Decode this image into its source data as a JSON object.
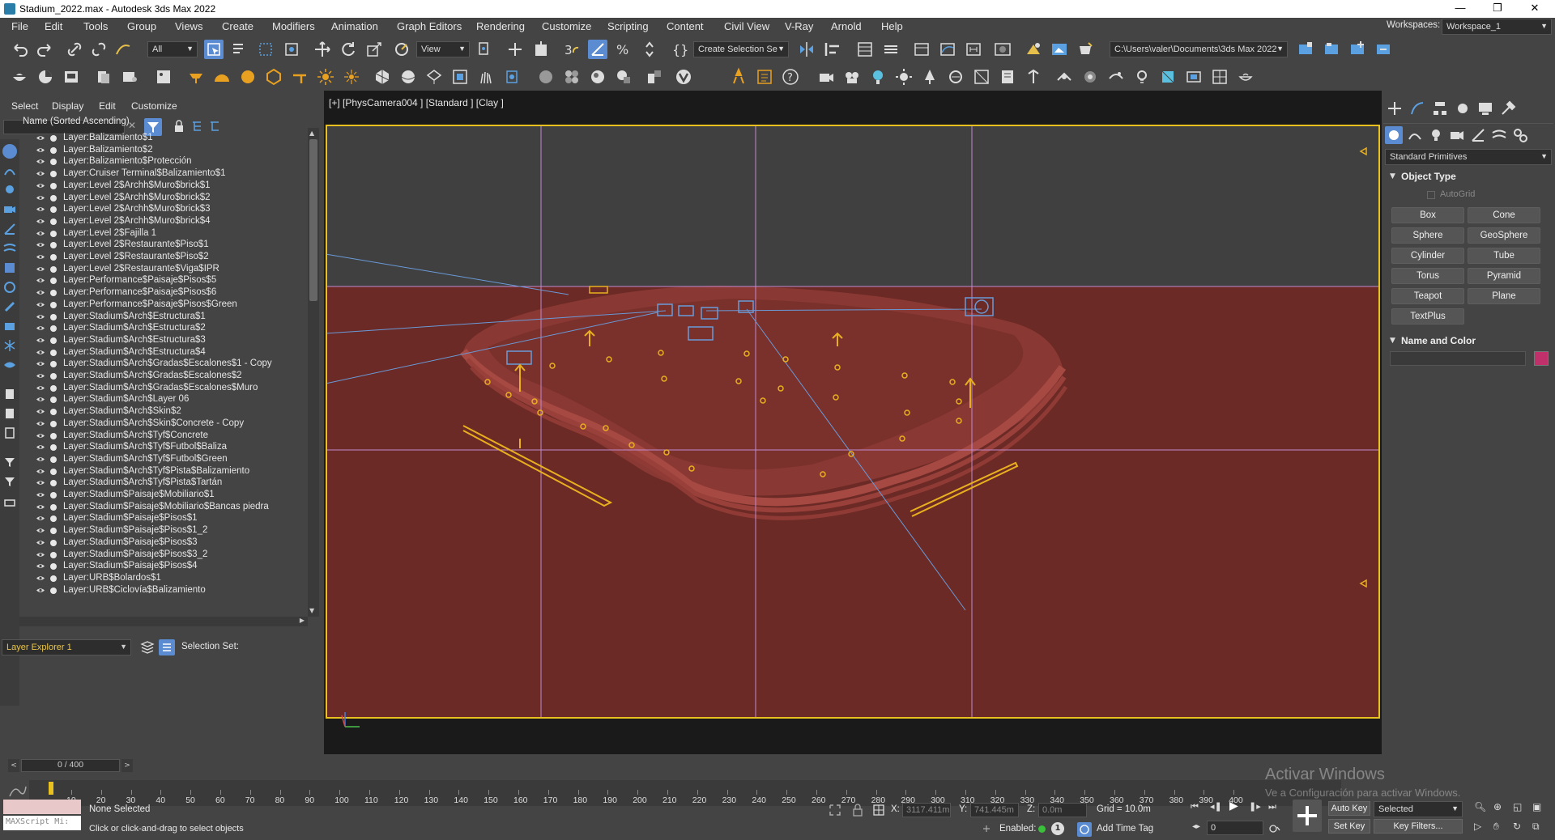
{
  "window": {
    "title": "Stadium_2022.max - Autodesk 3ds Max 2022"
  },
  "menu": [
    "File",
    "Edit",
    "Tools",
    "Group",
    "Views",
    "Create",
    "Modifiers",
    "Animation",
    "Graph Editors",
    "Rendering",
    "Customize",
    "Scripting",
    "Content",
    "Civil View",
    "V-Ray",
    "Arnold",
    "Help"
  ],
  "workspace": {
    "label": "Workspaces:",
    "value": "Workspace_1"
  },
  "toolbar": {
    "filter_value": "All",
    "view_value": "View",
    "selection_set_placeholder": "Create Selection Se",
    "path_value": "C:\\Users\\valer\\Documents\\3ds Max 2022"
  },
  "scene_explorer": {
    "menu": [
      "Select",
      "Display",
      "Edit",
      "Customize"
    ],
    "column_header": "Name (Sorted Ascending)",
    "layers": [
      "Layer:Balizamiento$1",
      "Layer:Balizamiento$2",
      "Layer:Balizamiento$Protección",
      "Layer:Cruiser Terminal$Balizamiento$1",
      "Layer:Level 2$Archh$Muro$brick$1",
      "Layer:Level 2$Archh$Muro$brick$2",
      "Layer:Level 2$Archh$Muro$brick$3",
      "Layer:Level 2$Archh$Muro$brick$4",
      "Layer:Level 2$Fajilla 1",
      "Layer:Level 2$Restaurante$Piso$1",
      "Layer:Level 2$Restaurante$Piso$2",
      "Layer:Level 2$Restaurante$Viga$IPR",
      "Layer:Performance$Paisaje$Pisos$5",
      "Layer:Performance$Paisaje$Pisos$6",
      "Layer:Performance$Paisaje$Pisos$Green",
      "Layer:Stadium$Arch$Estructura$1",
      "Layer:Stadium$Arch$Estructura$2",
      "Layer:Stadium$Arch$Estructura$3",
      "Layer:Stadium$Arch$Estructura$4",
      "Layer:Stadium$Arch$Gradas$Escalones$1 - Copy",
      "Layer:Stadium$Arch$Gradas$Escalones$2",
      "Layer:Stadium$Arch$Gradas$Escalones$Muro",
      "Layer:Stadium$Arch$Layer 06",
      "Layer:Stadium$Arch$Skin$2",
      "Layer:Stadium$Arch$Skin$Concrete - Copy",
      "Layer:Stadium$Arch$Tyf$Concrete",
      "Layer:Stadium$Arch$Tyf$Futbol$Baliza",
      "Layer:Stadium$Arch$Tyf$Futbol$Green",
      "Layer:Stadium$Arch$Tyf$Pista$Balizamiento",
      "Layer:Stadium$Arch$Tyf$Pista$Tartán",
      "Layer:Stadium$Paisaje$Mobiliario$1",
      "Layer:Stadium$Paisaje$Mobiliario$Bancas piedra",
      "Layer:Stadium$Paisaje$Pisos$1",
      "Layer:Stadium$Paisaje$Pisos$1_2",
      "Layer:Stadium$Paisaje$Pisos$3",
      "Layer:Stadium$Paisaje$Pisos$3_2",
      "Layer:Stadium$Paisaje$Pisos$4",
      "Layer:URB$Bolardos$1",
      "Layer:URB$Ciclovía$Balizamiento"
    ],
    "explorer_name": "Layer Explorer 1",
    "selection_set_label": "Selection Set:"
  },
  "viewport": {
    "label": "[+] [PhysCamera004 ] [Standard ] [Clay ]"
  },
  "command_panel": {
    "category": "Standard Primitives",
    "object_type_title": "Object Type",
    "autogrid": "AutoGrid",
    "buttons": [
      "Box",
      "Cone",
      "Sphere",
      "GeoSphere",
      "Cylinder",
      "Tube",
      "Torus",
      "Pyramid",
      "Teapot",
      "Plane",
      "TextPlus"
    ],
    "name_color_title": "Name and Color",
    "object_color": "#c0306a"
  },
  "timeline": {
    "frame_display": "0 / 400",
    "ticks": [
      "10",
      "20",
      "30",
      "40",
      "50",
      "60",
      "70",
      "80",
      "90",
      "100",
      "110",
      "120",
      "130",
      "140",
      "150",
      "160",
      "170",
      "180",
      "190",
      "200",
      "210",
      "220",
      "230",
      "240",
      "250",
      "260",
      "270",
      "280",
      "290",
      "300",
      "310",
      "320",
      "330",
      "340",
      "350",
      "360",
      "370",
      "380",
      "390",
      "400"
    ]
  },
  "status": {
    "maxscript": "MAXScript Mi:",
    "selection": "None Selected",
    "prompt": "Click or click-and-drag to select objects",
    "x_label": "X:",
    "x_value": "3117.411m",
    "y_label": "Y:",
    "y_value": "741.445m",
    "z_label": "Z:",
    "z_value": "0.0m",
    "grid": "Grid = 10.0m",
    "enabled": "Enabled:",
    "add_time_tag": "Add Time Tag",
    "auto_key": "Auto Key",
    "set_key": "Set Key",
    "key_mode": "Selected",
    "key_filters": "Key Filters...",
    "frame": "0"
  },
  "activation": {
    "title": "Activar Windows",
    "subtitle": "Ve a Configuración para activar Windows."
  }
}
